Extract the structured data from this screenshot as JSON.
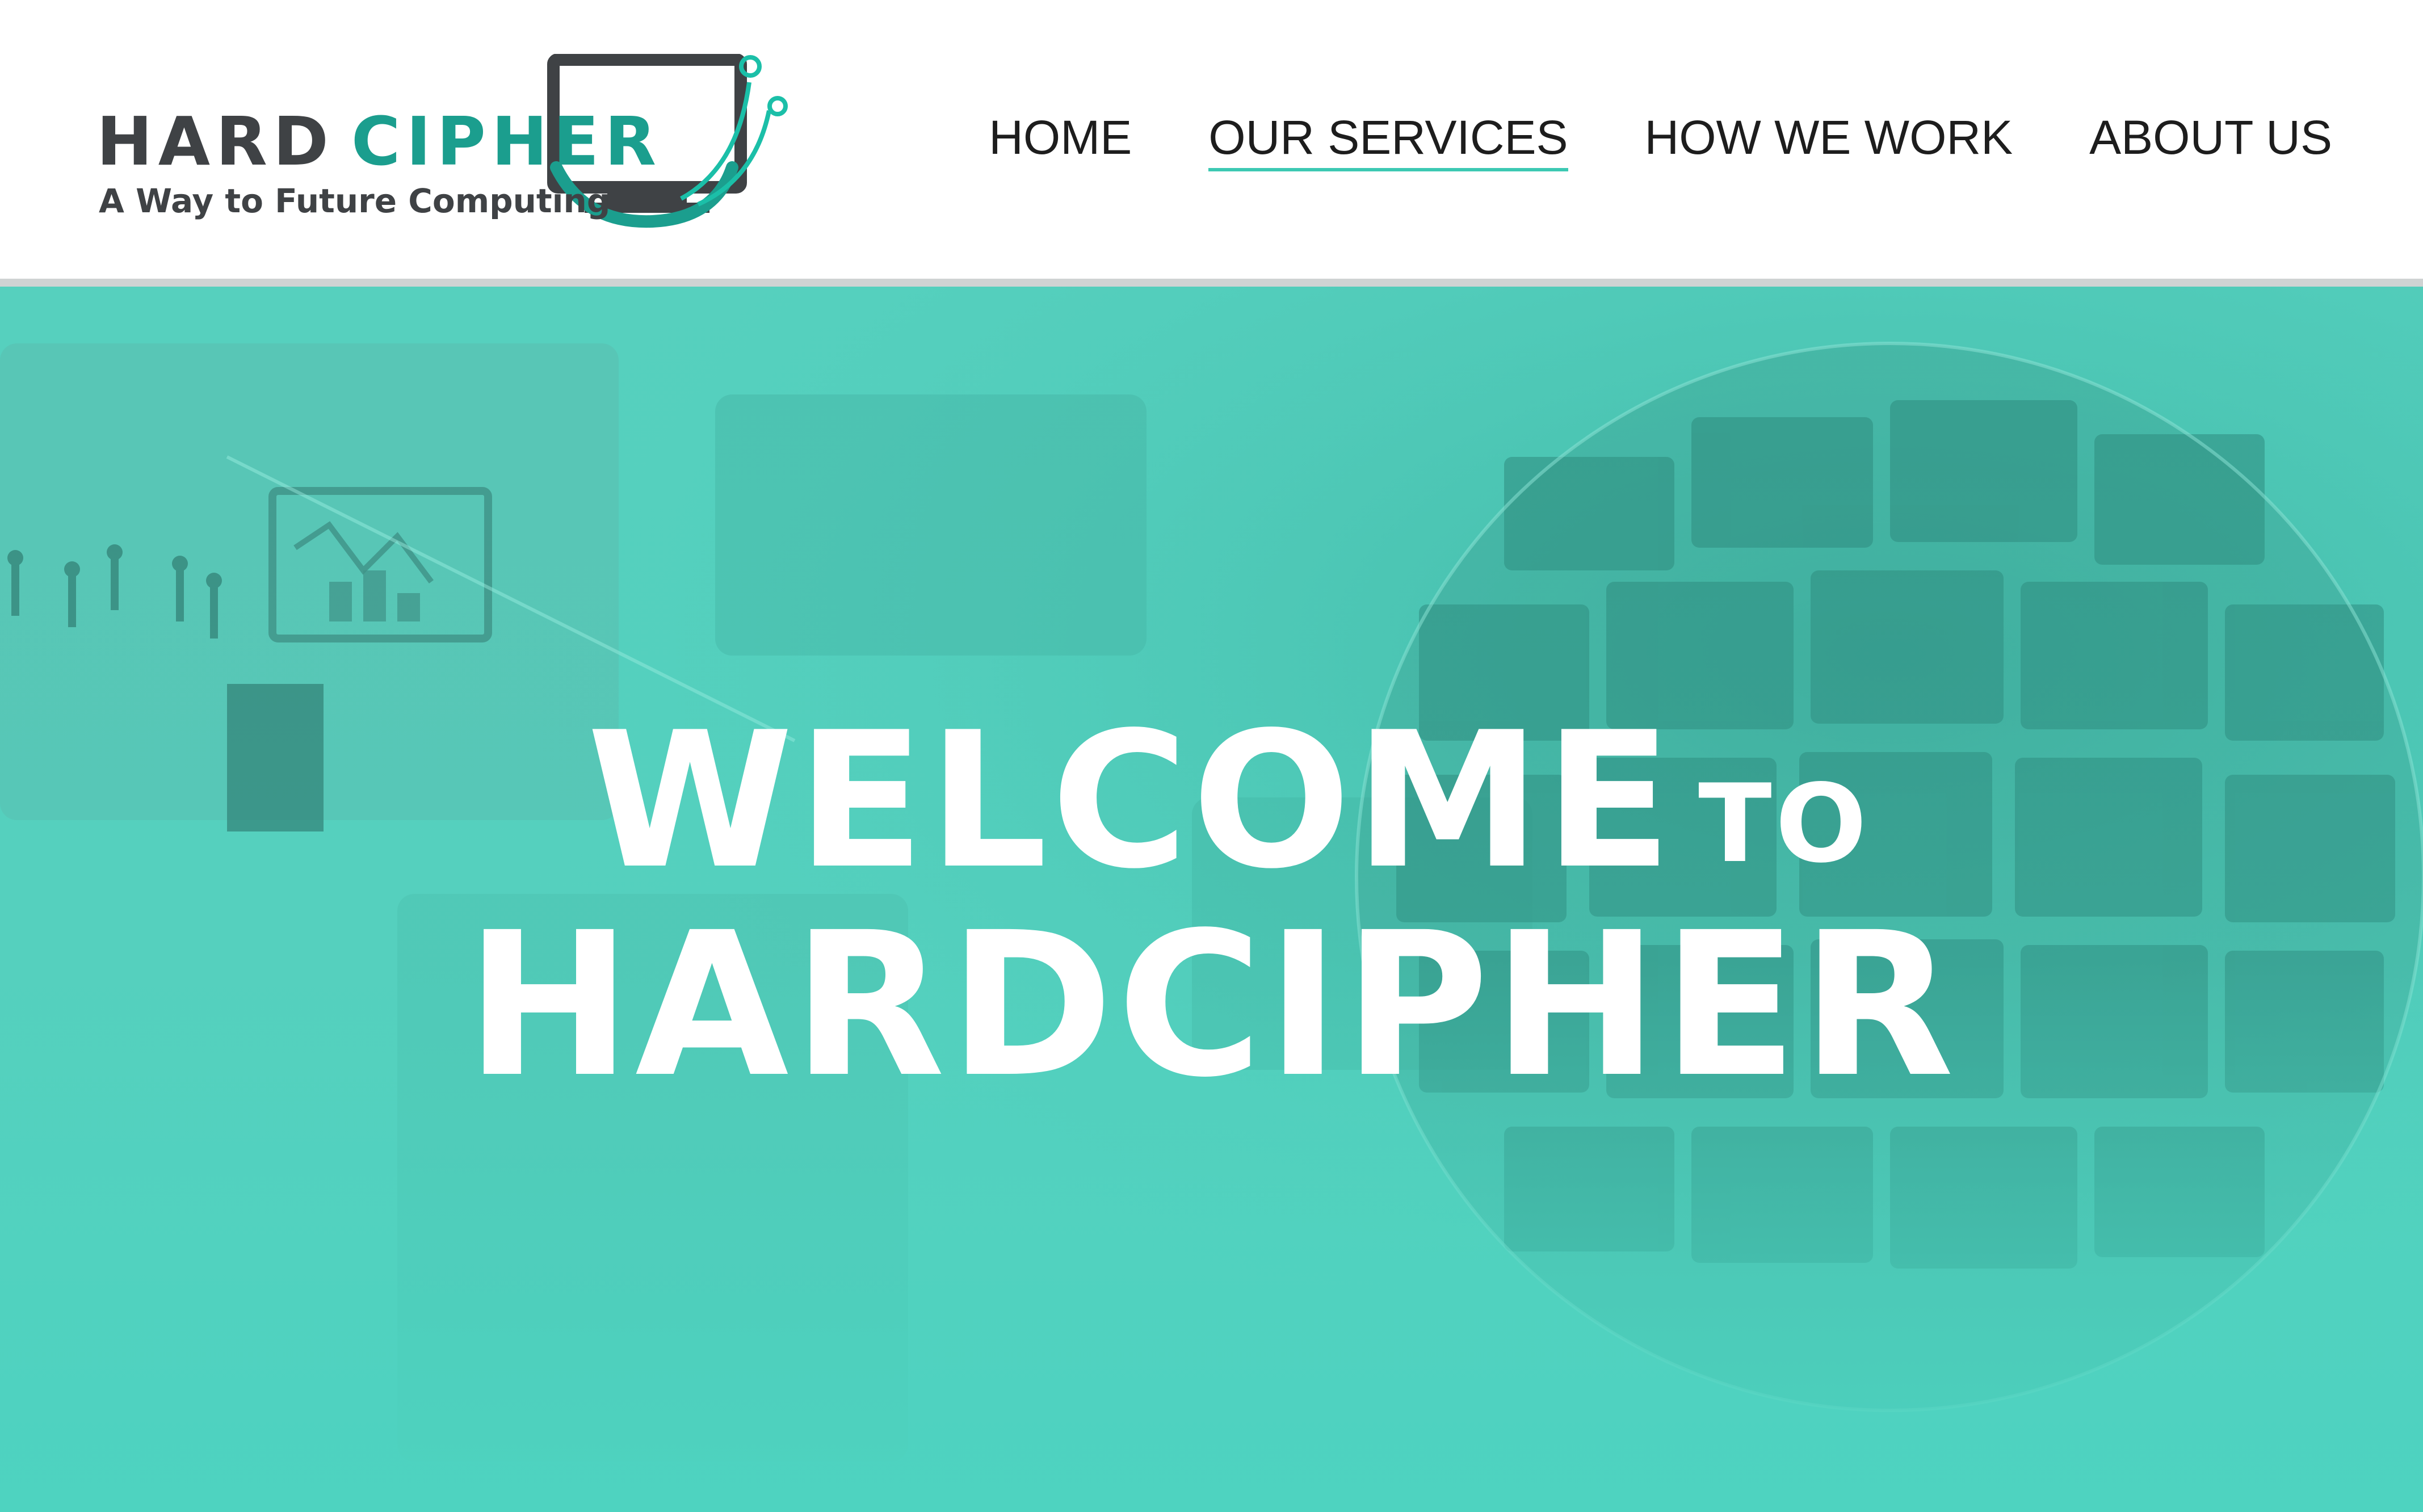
{
  "header": {
    "logo": {
      "word_hard": "HARD",
      "word_cipher": "CIPHER",
      "tagline": "A Way to Future Computing"
    },
    "nav": [
      {
        "label": "HOME",
        "active": false
      },
      {
        "label": "OUR SERVICES",
        "active": true
      },
      {
        "label": "HOW WE WORK",
        "active": false
      },
      {
        "label": "ABOUT US",
        "active": false
      }
    ]
  },
  "hero": {
    "title_welcome": "WELCOME",
    "title_to": "TO",
    "title_brand": "HARDCIPHER"
  },
  "colors": {
    "accent": "#3cc9b3",
    "hero_background": "#4dd3c0",
    "logo_dark": "#3f4245",
    "logo_teal": "#1b9e8e",
    "nav_text": "#1d1d1d"
  },
  "icons": {
    "logo_graphic": "monitor-circuit-icon"
  }
}
